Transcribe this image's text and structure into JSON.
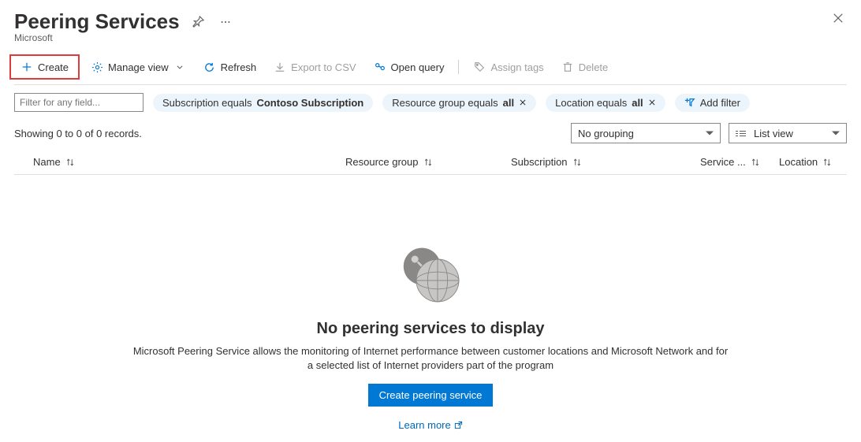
{
  "header": {
    "title": "Peering Services",
    "subtitle": "Microsoft"
  },
  "toolbar": {
    "create": "Create",
    "manage_view": "Manage view",
    "refresh": "Refresh",
    "export_csv": "Export to CSV",
    "open_query": "Open query",
    "assign_tags": "Assign tags",
    "delete": "Delete"
  },
  "filters": {
    "placeholder": "Filter for any field...",
    "subscription": {
      "label": "Subscription equals",
      "value": "Contoso Subscription"
    },
    "resource_group": {
      "label": "Resource group equals",
      "value": "all"
    },
    "location": {
      "label": "Location equals",
      "value": "all"
    },
    "add_filter": "Add filter"
  },
  "status": {
    "records_text": "Showing 0 to 0 of 0 records.",
    "grouping": "No grouping",
    "view_mode": "List view"
  },
  "columns": {
    "name": "Name",
    "resource_group": "Resource group",
    "subscription": "Subscription",
    "service_provider": "Service ...",
    "location": "Location"
  },
  "empty": {
    "title": "No peering services to display",
    "description": "Microsoft Peering Service allows the monitoring of Internet performance between customer locations and Microsoft Network and for a selected list of Internet providers part of the program",
    "button": "Create peering service",
    "learn_more": "Learn more"
  }
}
